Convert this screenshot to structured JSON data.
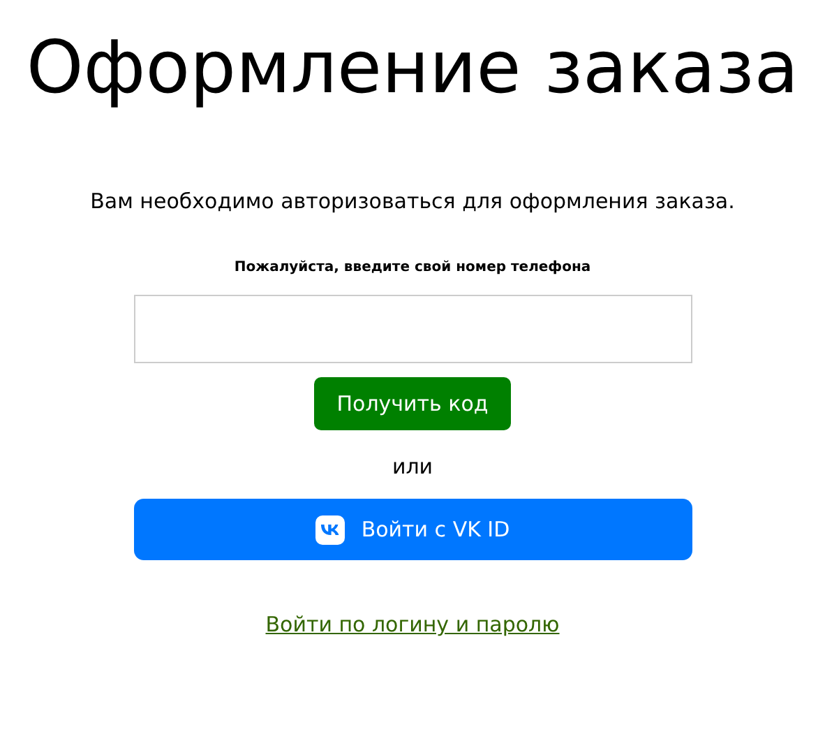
{
  "title": "Оформление заказа",
  "message": "Вам необходимо авторизоваться для оформления заказа.",
  "phone": {
    "label": "Пожалуйста, введите свой номер телефона"
  },
  "get_code_button": "Получить код",
  "separator": "или",
  "vk_button": "Войти с VK ID",
  "login_link": "Войти по логину и паролю"
}
